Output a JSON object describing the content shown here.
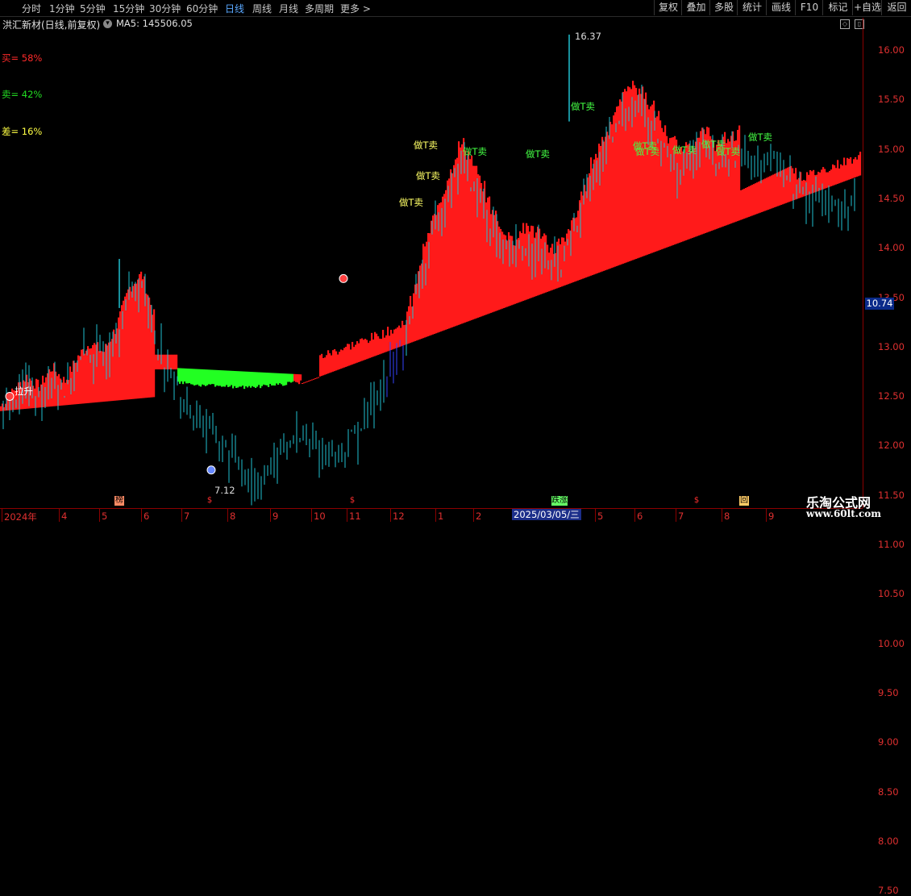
{
  "toolbar": {
    "period_tabs": [
      "分时",
      "1分钟",
      "5分钟",
      "15分钟",
      "30分钟",
      "60分钟",
      "日线",
      "周线",
      "月线",
      "多周期",
      "更多 >"
    ],
    "active_tab": "日线",
    "right_buttons": [
      "复权",
      "叠加",
      "多股",
      "统计",
      "画线",
      "F10",
      "标记",
      "+自选",
      "返回"
    ]
  },
  "info": {
    "stock_name": "洪汇新材(日线,前复权)",
    "ma_label": "MA5: 145506.05"
  },
  "stats": [
    {
      "label": "买= 58%",
      "color": "#ff2a2a"
    },
    {
      "label": "卖= 42%",
      "color": "#22dd22"
    },
    {
      "label": "差= 16%",
      "color": "#ffff44"
    }
  ],
  "colors": {
    "up": "#ff1a1a",
    "down": "#22ff22",
    "candle": "#20c0d0",
    "axis": "#e03030",
    "buy_text": "#ffff66",
    "sell_text": "#44ff44",
    "high_buy": "#3344ff",
    "low_buy": "#ffee00"
  },
  "current_price": "10.74",
  "selected_date": "2025/03/05/三",
  "markers": [
    {
      "label": "榜",
      "color": "#ff8c66"
    },
    {
      "label": "$",
      "color": "#ff3030"
    },
    {
      "label": "$",
      "color": "#ff3030"
    },
    {
      "label": "跌涨",
      "color": "#66ff66"
    },
    {
      "label": "$",
      "color": "#ff3030"
    },
    {
      "label": "回",
      "color": "#ffcc66"
    }
  ],
  "signals": [
    {
      "label": "拉升",
      "color": "#ffffff"
    },
    {
      "label": "做T卖",
      "color": "#ffff66"
    },
    {
      "label": "做T卖",
      "color": "#ffff66"
    },
    {
      "label": "做T卖",
      "color": "#ffff66"
    },
    {
      "label": "做T卖",
      "color": "#44ff44"
    },
    {
      "label": "做T卖",
      "color": "#44ff44"
    },
    {
      "label": "做T卖",
      "color": "#44ff44"
    },
    {
      "label": "做T卖",
      "color": "#44ff44"
    },
    {
      "label": "做T卖",
      "color": "#44ff44"
    },
    {
      "label": "做T卖",
      "color": "#44ff44"
    },
    {
      "label": "做T卖",
      "color": "#44ff44"
    },
    {
      "label": "做T卖",
      "color": "#44ff44"
    },
    {
      "label": "做T卖",
      "color": "#44ff44"
    }
  ],
  "high_label": "16.37",
  "low_label": "7.12",
  "watermark": {
    "line1": "乐淘公式网",
    "line2": "www.60lt.com"
  },
  "chart_data": {
    "type": "bar",
    "title": "洪汇新材(日线,前复权)",
    "y_ticks": [
      "16.00",
      "15.50",
      "15.00",
      "14.50",
      "14.00",
      "13.50",
      "13.00",
      "12.50",
      "12.00",
      "11.50",
      "11.00",
      "10.50",
      "10.00",
      "9.50",
      "9.00",
      "8.50",
      "8.00",
      "7.50"
    ],
    "ylim": [
      7.25,
      16.45
    ],
    "x_ticks": [
      "2024年",
      "4",
      "5",
      "6",
      "7",
      "8",
      "9",
      "10",
      "11",
      "12",
      "1",
      "2",
      "3",
      "5",
      "6",
      "7",
      "8",
      "9"
    ],
    "series": [
      {
        "name": "close",
        "values": [
          8.6,
          8.9,
          9.2,
          9.0,
          9.4,
          9.1,
          9.6,
          9.9,
          9.7,
          10.2,
          11.0,
          11.3,
          10.4,
          9.6,
          9.0,
          8.7,
          8.4,
          8.1,
          7.8,
          7.5,
          7.2,
          7.5,
          7.9,
          8.2,
          8.0,
          7.9,
          7.7,
          8.0,
          8.3,
          8.9,
          9.3,
          9.8,
          10.5,
          11.6,
          12.4,
          13.2,
          13.8,
          13.2,
          12.6,
          12.0,
          11.8,
          12.1,
          11.9,
          11.6,
          11.8,
          12.4,
          13.3,
          13.9,
          14.4,
          15.0,
          14.8,
          14.4,
          13.9,
          13.6,
          13.8,
          14.0,
          13.7,
          13.9,
          14.0,
          13.8,
          13.9,
          13.6,
          13.2,
          12.9,
          13.1,
          12.8,
          12.9,
          13.2
        ]
      }
    ]
  }
}
